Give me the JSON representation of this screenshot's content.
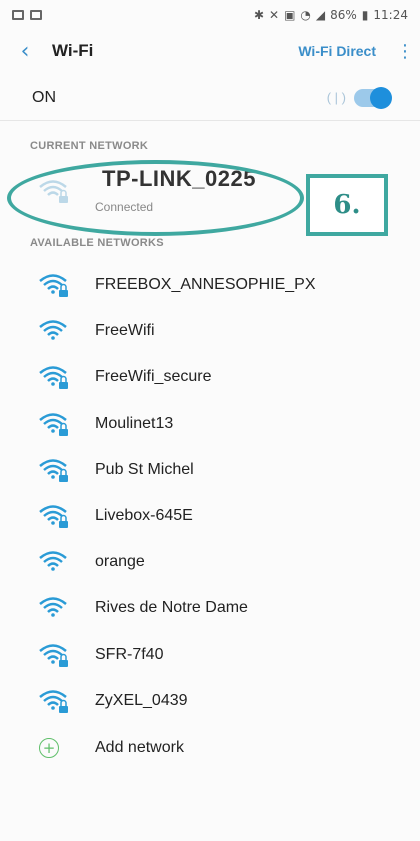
{
  "status_bar": {
    "battery": "86%",
    "time": "11:24"
  },
  "app_bar": {
    "title": "Wi-Fi",
    "wifi_direct_label": "Wi-Fi Direct"
  },
  "toggle_row": {
    "label": "ON",
    "enabled": true
  },
  "current_network": {
    "section_label": "CURRENT NETWORK",
    "name": "TP-LINK_0225",
    "status": "Connected",
    "annotation": "6."
  },
  "available_networks": {
    "section_label": "AVAILABLE NETWORKS",
    "items": [
      {
        "name": "FREEBOX_ANNESOPHIE_PX",
        "secured": true
      },
      {
        "name": "FreeWifi",
        "secured": false
      },
      {
        "name": "FreeWifi_secure",
        "secured": true
      },
      {
        "name": "Moulinet13",
        "secured": true
      },
      {
        "name": "Pub St Michel",
        "secured": true
      },
      {
        "name": "Livebox-645E",
        "secured": true
      },
      {
        "name": "orange",
        "secured": false
      },
      {
        "name": "Rives de Notre Dame",
        "secured": false
      },
      {
        "name": "SFR-7f40",
        "secured": true
      },
      {
        "name": "ZyXEL_0439",
        "secured": true
      }
    ],
    "add_label": "Add network"
  },
  "colors": {
    "accent": "#3a8ec9",
    "wifi_icon": "#2a9bd6",
    "annotation": "#3fa8a0"
  }
}
